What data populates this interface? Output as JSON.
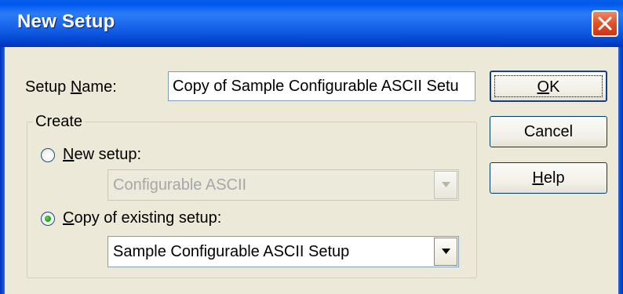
{
  "window": {
    "title": "New Setup"
  },
  "setup_name": {
    "label_pre": "Setup ",
    "label_mnemonic": "N",
    "label_post": "ame:",
    "value": "Copy of Sample Configurable ASCII Setu"
  },
  "create_group": {
    "legend": "Create",
    "new_setup": {
      "mnemonic": "N",
      "label_rest": "ew setup:",
      "selected": false,
      "combo_value": "Configurable ASCII",
      "combo_enabled": false
    },
    "copy_existing": {
      "mnemonic": "C",
      "label_rest": "opy of existing setup:",
      "selected": true,
      "combo_value": "Sample Configurable ASCII Setup",
      "combo_enabled": true
    }
  },
  "buttons": {
    "ok_mnemonic": "O",
    "ok_rest": "K",
    "cancel": "Cancel",
    "help_mnemonic": "H",
    "help_rest": "elp"
  },
  "icons": {
    "close": "close-icon",
    "dropdown": "chevron-down-icon"
  },
  "colors": {
    "titlebar": "#0058ee",
    "client": "#ece9d8",
    "close_button": "#e2552c",
    "radio_selected": "#21a121"
  }
}
